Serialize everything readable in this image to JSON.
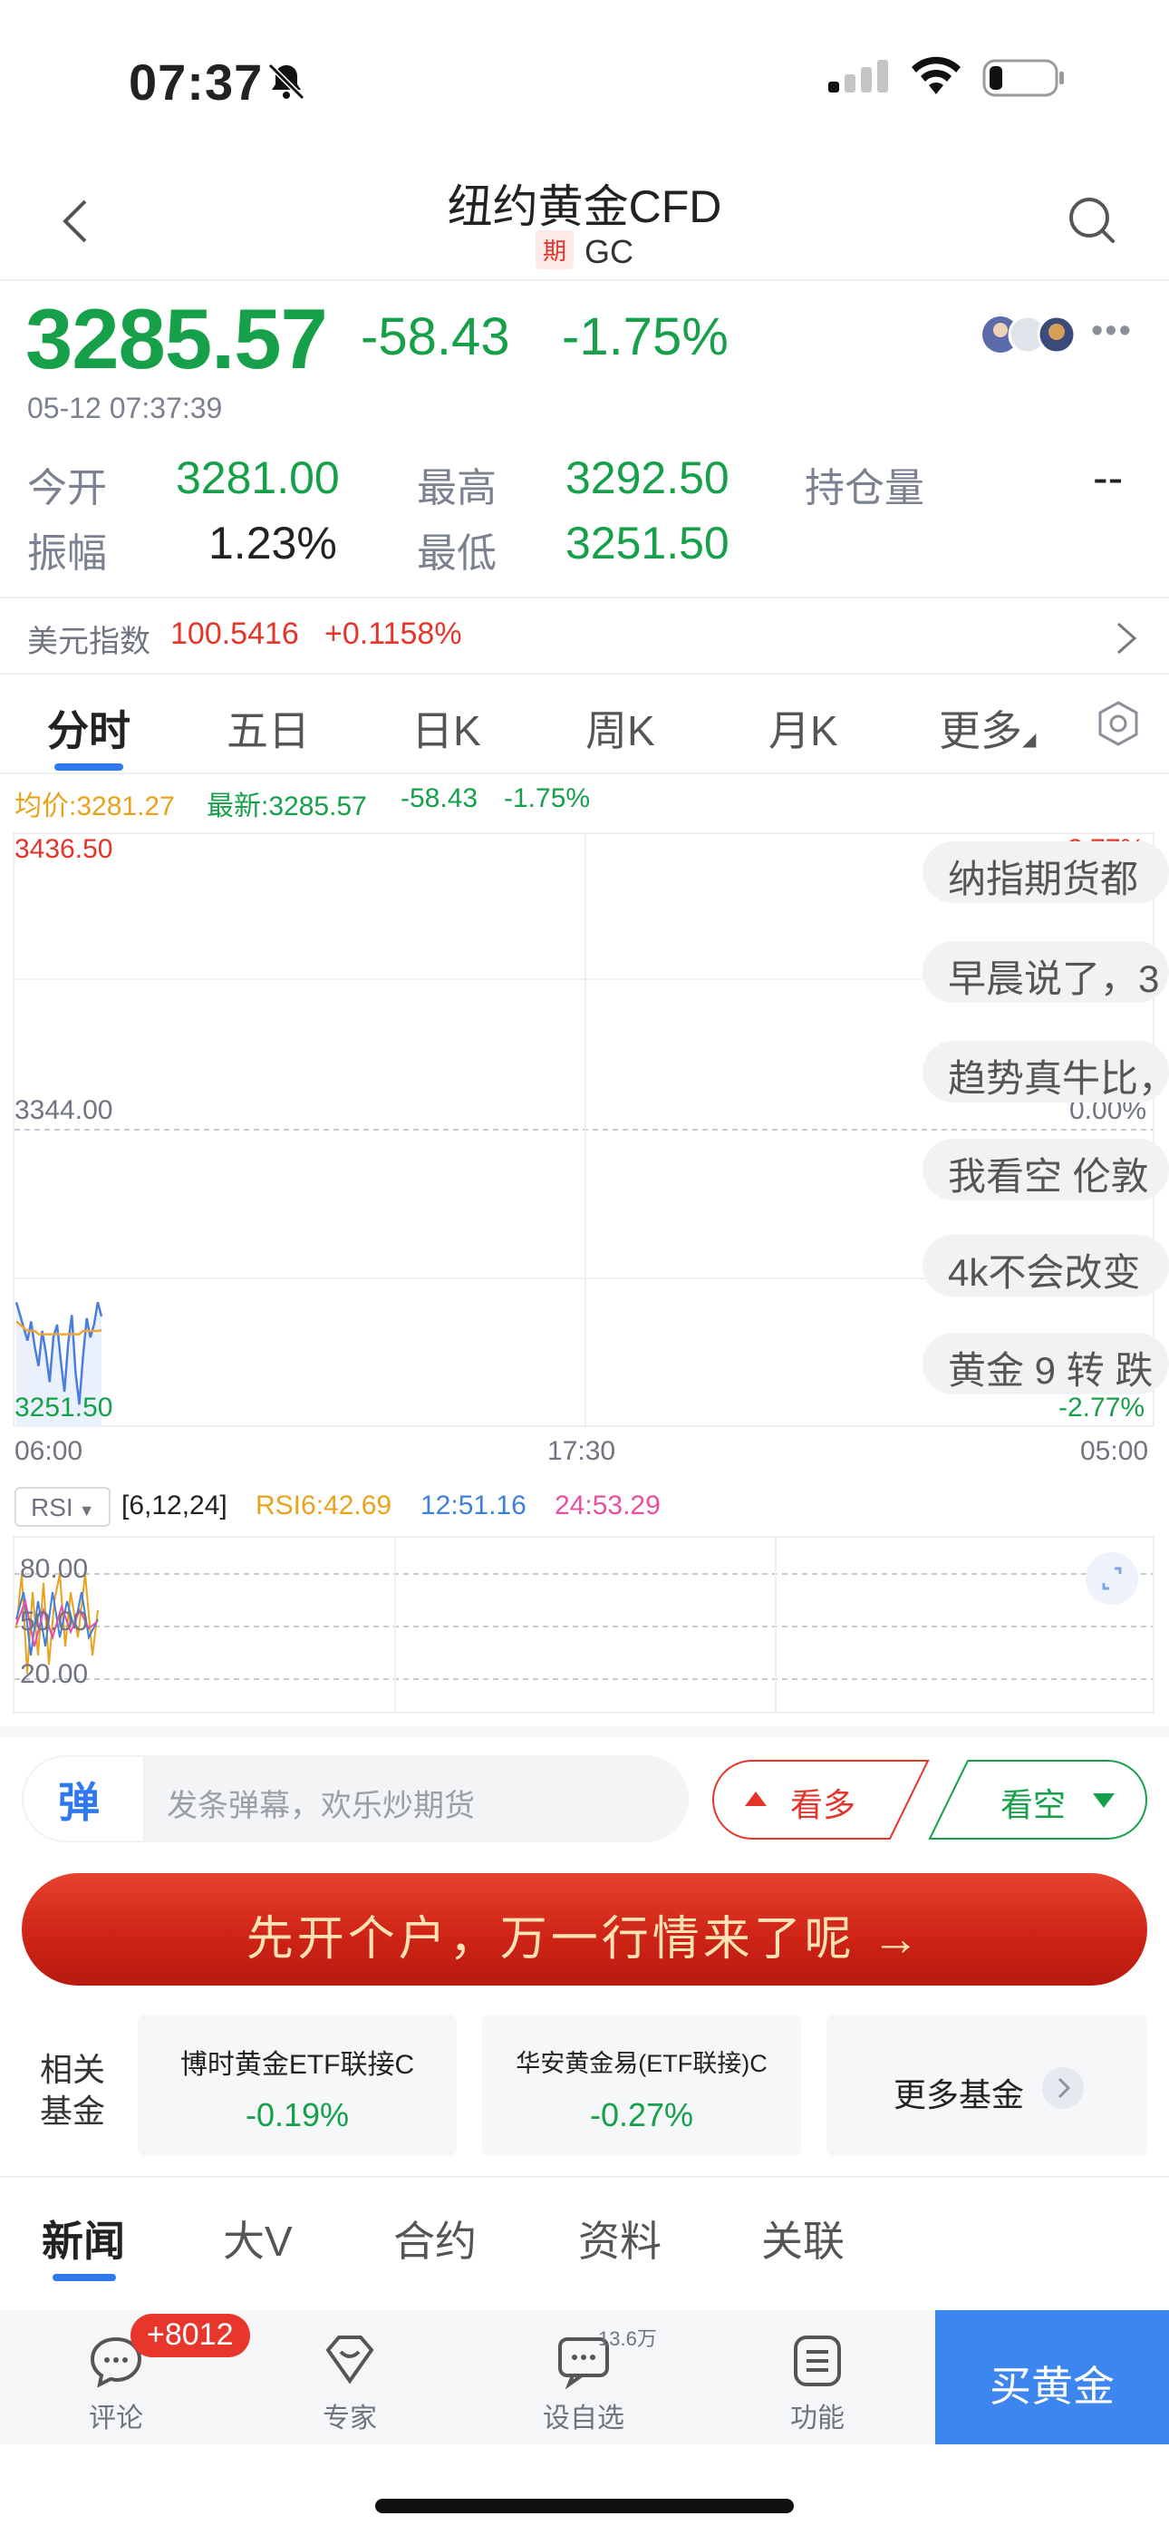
{
  "status_bar": {
    "time": "07:37"
  },
  "header": {
    "title": "纽约黄金CFD",
    "tag": "期",
    "code": "GC"
  },
  "quote": {
    "price": "3285.57",
    "change": "-58.43",
    "change_pct": "-1.75%",
    "datetime": "05-12 07:37:39",
    "stats": {
      "open_label": "今开",
      "open": "3281.00",
      "high_label": "最高",
      "high": "3292.50",
      "oi_label": "持仓量",
      "oi": "--",
      "amp_label": "振幅",
      "amp": "1.23%",
      "low_label": "最低",
      "low": "3251.50"
    }
  },
  "dollar_index": {
    "label": "美元指数",
    "value": "100.5416",
    "change_pct": "+0.1158%"
  },
  "chart_tabs": [
    "分时",
    "五日",
    "日K",
    "周K",
    "月K",
    "更多"
  ],
  "chart": {
    "legend": {
      "avg": "均价:3281.27",
      "latest": "最新:3285.57",
      "change": "-58.43",
      "pct": "-1.75%"
    },
    "y_top": "3436.50",
    "y_mid": "3344.00",
    "y_bottom": "3251.50",
    "pct_top": "2.77%",
    "pct_mid": "0.00%",
    "pct_bottom": "-2.77%",
    "x_labels": [
      "06:00",
      "17:30",
      "05:00"
    ]
  },
  "chart_data": {
    "type": "line",
    "title": "",
    "xlabel": "",
    "ylabel": "",
    "ylim": [
      3251.5,
      3436.5
    ],
    "x_range": [
      "06:00",
      "05:00"
    ],
    "series": [
      {
        "values": [
          3290,
          3286,
          3282,
          3278,
          3284,
          3276,
          3270,
          3281,
          3274,
          3265,
          3279,
          3283,
          3272,
          3262,
          3277,
          3286,
          3268,
          3258,
          3273,
          3285,
          3279,
          3283,
          3290,
          3285.57
        ],
        "color": "#4a7de0"
      },
      {
        "values": [
          3284,
          3283,
          3282,
          3281,
          3281,
          3281,
          3280,
          3280,
          3280,
          3280,
          3280,
          3280,
          3280,
          3280,
          3280,
          3280,
          3280,
          3280,
          3281,
          3281,
          3281,
          3281,
          3281,
          3281.27
        ],
        "color": "#f0a63a"
      }
    ],
    "rsi": {
      "levels": [
        "80.00",
        "50.00",
        "20.00"
      ],
      "params": "[6,12,24]",
      "rsi6": "RSI6:42.69",
      "rsi12": "12:51.16",
      "rsi24": "24:53.29"
    }
  },
  "rsi_panel": {
    "selector": "RSI"
  },
  "danmu": [
    "纳指期货都",
    "早晨说了，3",
    "趋势真牛比，",
    "我看空 伦敦",
    "4k不会改变",
    "黄金 9 转 跌"
  ],
  "danmu_input": {
    "badge": "弹",
    "placeholder": "发条弹幕，欢乐炒期货",
    "bull": "看多",
    "bear": "看空"
  },
  "banner": {
    "text": "先开个户，万一行情来了呢 →"
  },
  "funds": {
    "side_label_1": "相关",
    "side_label_2": "基金",
    "items": [
      {
        "name": "博时黄金ETF联接C",
        "pct": "-0.19%"
      },
      {
        "name": "华安黄金易(ETF联接)C",
        "pct": "-0.27%"
      }
    ],
    "more": "更多基金"
  },
  "bottom_tabs": [
    "新闻",
    "大V",
    "合约",
    "资料",
    "关联"
  ],
  "toolbar": {
    "comments": "评论",
    "comments_badge": "+8012",
    "expert": "专家",
    "watch": "设自选",
    "watch_count": "13.6万",
    "function": "功能",
    "buy": "买黄金"
  },
  "colors": {
    "up": "#e5352b",
    "down": "#16a04a",
    "accent": "#2f78f0",
    "buy": "#3d86f0"
  }
}
